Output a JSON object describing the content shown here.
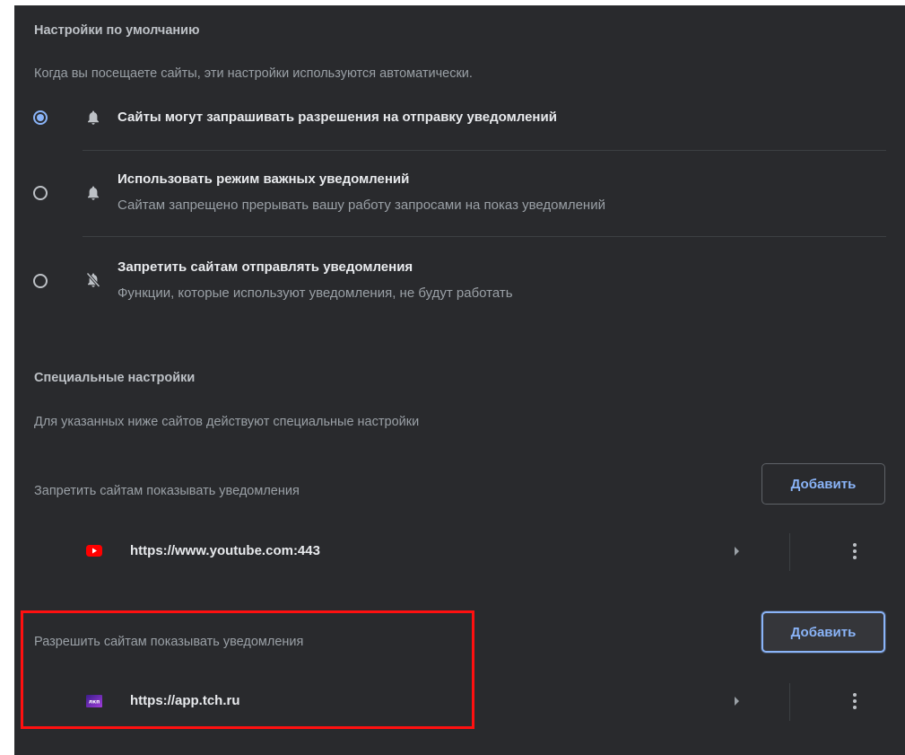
{
  "defaults": {
    "title": "Настройки по умолчанию",
    "description": "Когда вы посещаете сайты, эти настройки используются автоматически.",
    "options": [
      {
        "label": "Сайты могут запрашивать разрешения на отправку уведомлений",
        "sublabel": "",
        "checked": true,
        "icon": "bell-icon"
      },
      {
        "label": "Использовать режим важных уведомлений",
        "sublabel": "Сайтам запрещено прерывать вашу работу запросами на показ уведомлений",
        "checked": false,
        "icon": "bell-icon"
      },
      {
        "label": "Запретить сайтам отправлять уведомления",
        "sublabel": "Функции, которые используют уведомления, не будут работать",
        "checked": false,
        "icon": "bell-off-icon"
      }
    ]
  },
  "custom": {
    "title": "Специальные настройки",
    "description": "Для указанных ниже сайтов действуют специальные настройки",
    "block": {
      "header": "Запретить сайтам показывать уведомления",
      "add_label": "Добавить",
      "sites": [
        {
          "url": "https://www.youtube.com:443",
          "icon": "youtube-icon"
        }
      ]
    },
    "allow": {
      "header": "Разрешить сайтам показывать уведомления",
      "add_label": "Добавить",
      "sites": [
        {
          "url": "https://app.tch.ru",
          "icon": "tch-icon",
          "icon_text": "лкп"
        }
      ]
    }
  },
  "colors": {
    "background": "#292a2d",
    "accent": "#8ab4f8",
    "text_primary": "#e8eaed",
    "text_secondary": "#9aa0a6",
    "highlight": "#ff1010",
    "youtube_red": "#ff0000"
  }
}
